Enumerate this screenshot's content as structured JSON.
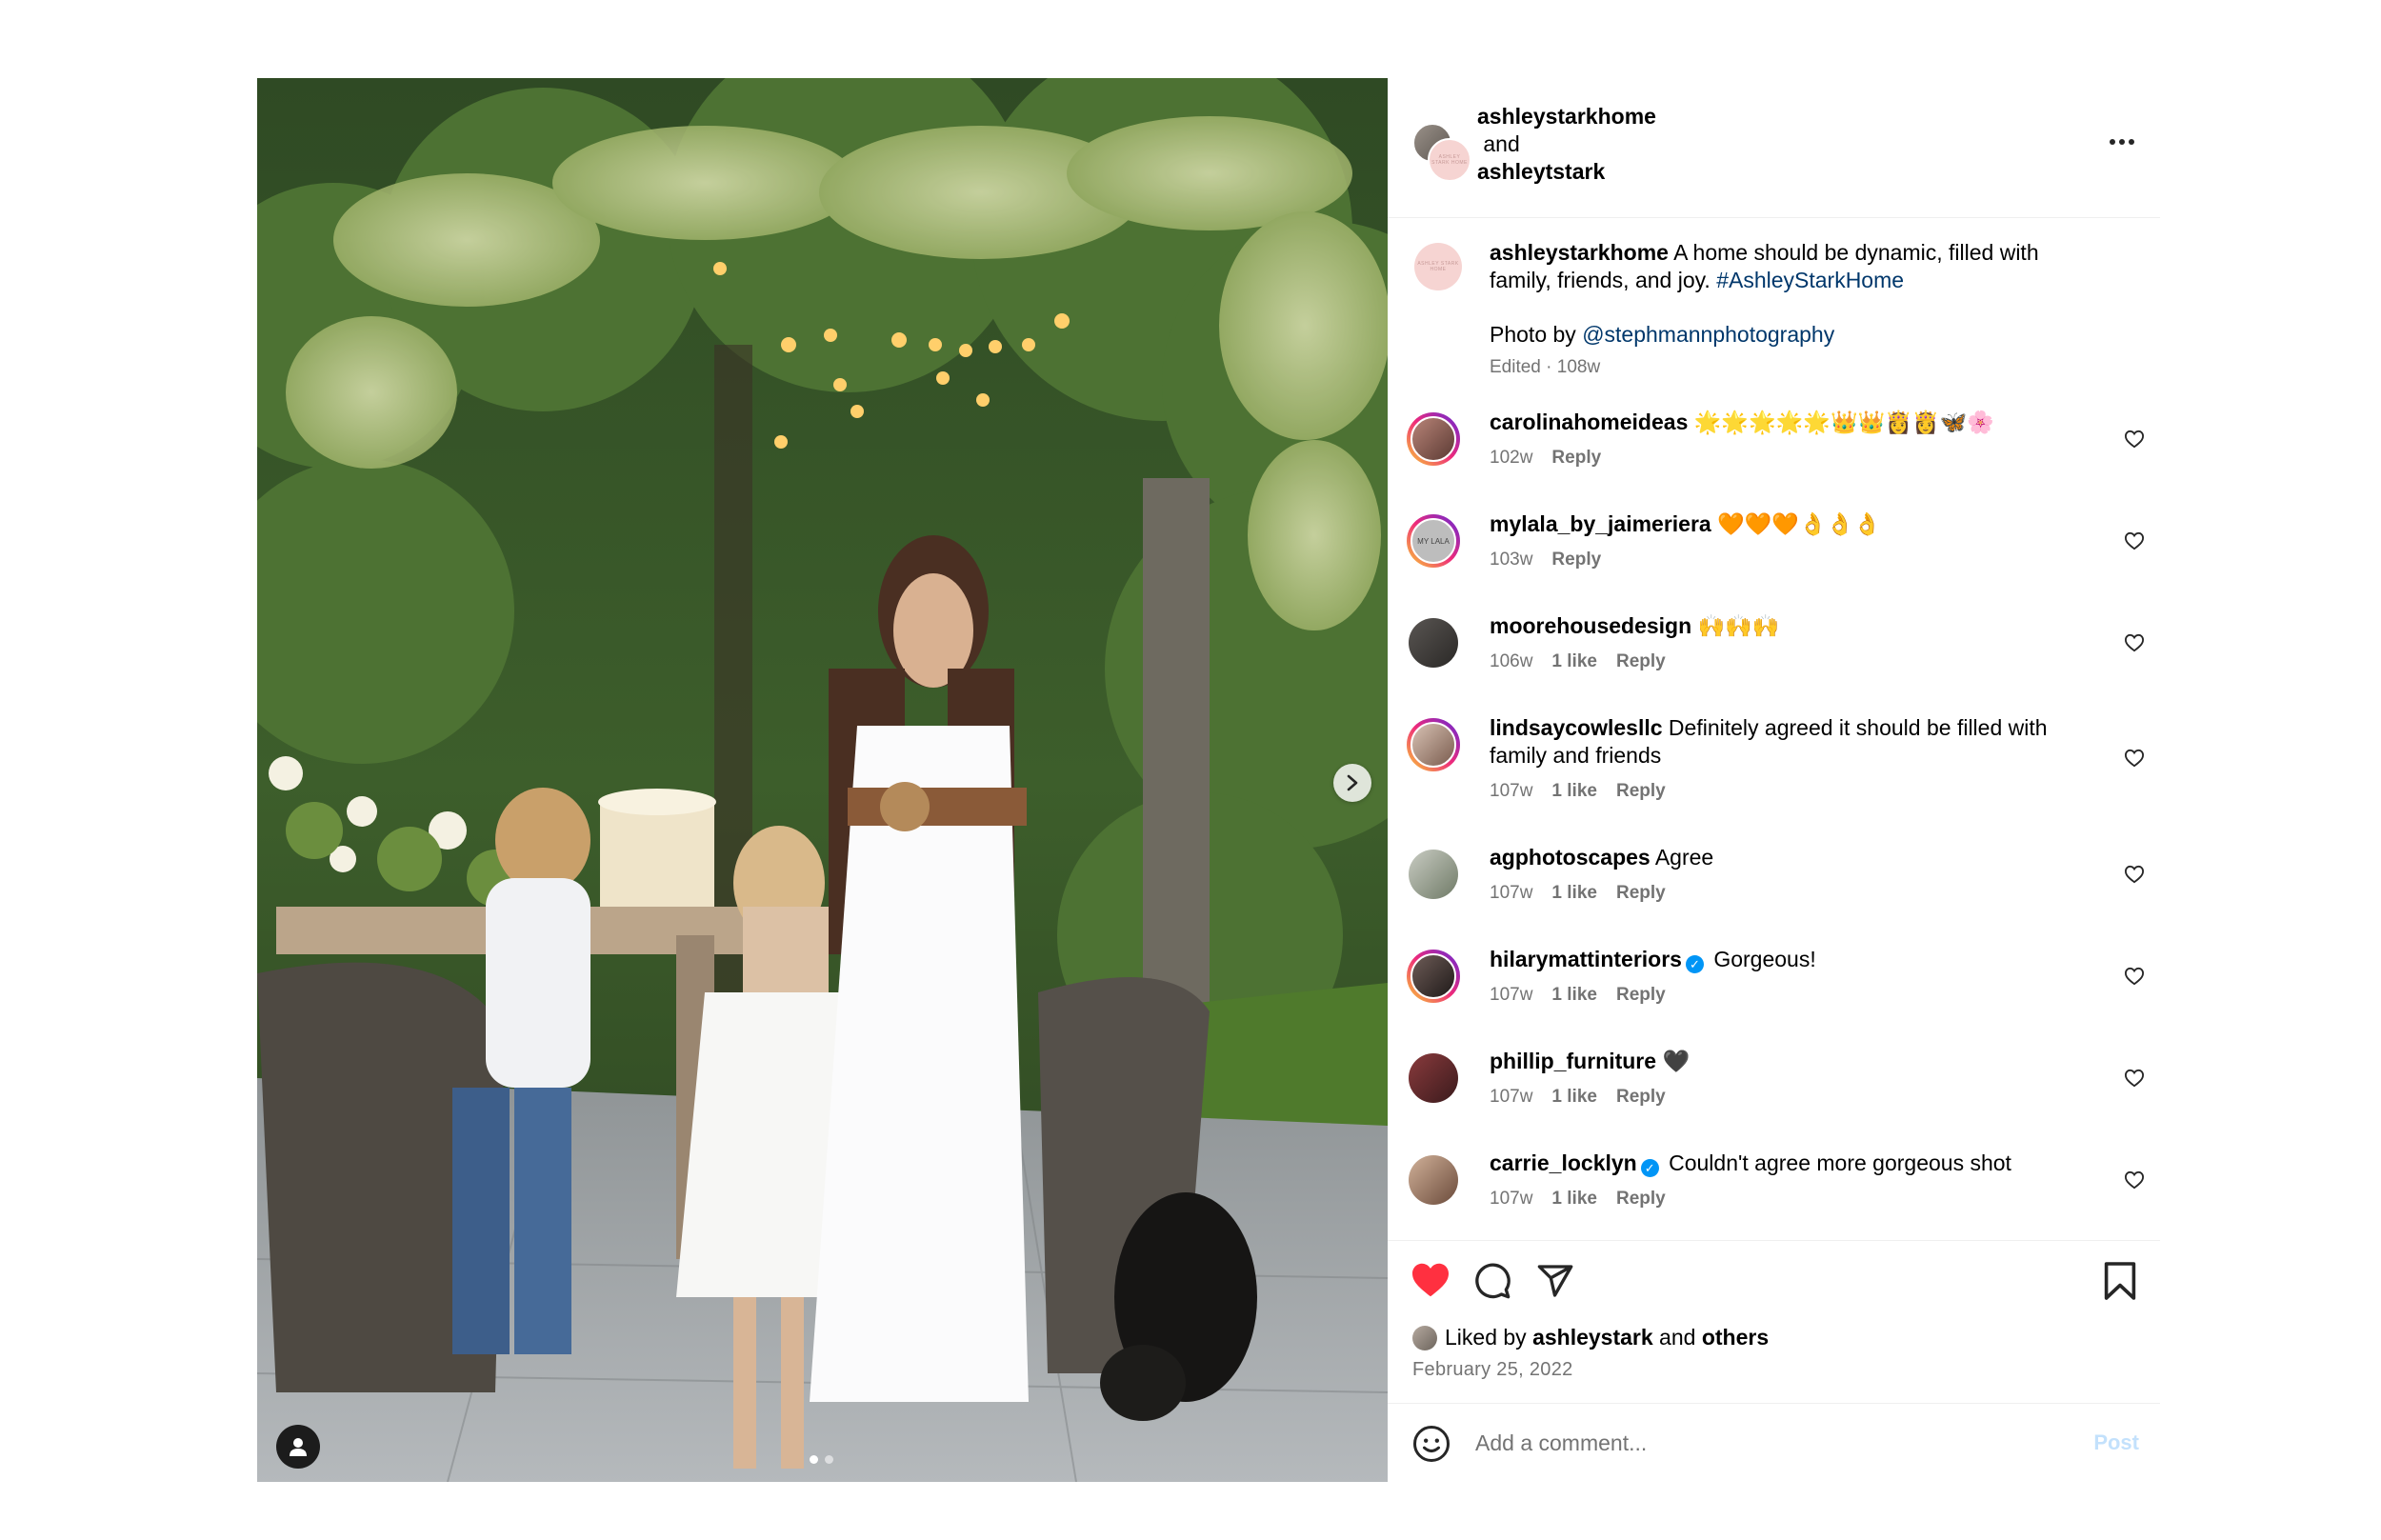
{
  "header": {
    "user1": "ashleystarkhome",
    "connector": "and",
    "user2": "ashleytstark",
    "mini_logo": "ASHLEY STARK HOME"
  },
  "caption": {
    "user": "ashleystarkhome",
    "text": "A home should be dynamic, filled with family, friends, and joy.",
    "hashtag": "#AshleyStarkHome",
    "photo_by": "Photo by",
    "photo_handle": "@stephmannphotography",
    "meta": "Edited · 108w"
  },
  "comments": [
    {
      "user": "carolinahomeideas",
      "text": "🌟🌟🌟🌟🌟👑👑👸👸🦋🌸",
      "time": "102w",
      "likes": "",
      "reply": "Reply",
      "verified": false
    },
    {
      "user": "mylala_by_jaimeriera",
      "text": "🧡🧡🧡👌👌👌",
      "time": "103w",
      "likes": "",
      "reply": "Reply",
      "verified": false,
      "avatar_text": "MY LALA"
    },
    {
      "user": "moorehousedesign",
      "text": "🙌🙌🙌",
      "time": "106w",
      "likes": "1 like",
      "reply": "Reply",
      "verified": false
    },
    {
      "user": "lindsaycowlesllc",
      "text": "Definitely agreed it should be filled with family and friends",
      "time": "107w",
      "likes": "1 like",
      "reply": "Reply",
      "verified": false
    },
    {
      "user": "agphotoscapes",
      "text": "Agree",
      "time": "107w",
      "likes": "1 like",
      "reply": "Reply",
      "verified": false
    },
    {
      "user": "hilarymattinteriors",
      "text": "Gorgeous!",
      "time": "107w",
      "likes": "1 like",
      "reply": "Reply",
      "verified": true
    },
    {
      "user": "phillip_furniture",
      "text": "🖤",
      "time": "107w",
      "likes": "1 like",
      "reply": "Reply",
      "verified": false
    },
    {
      "user": "carrie_locklyn",
      "text": "Couldn't agree more gorgeous shot",
      "time": "107w",
      "likes": "1 like",
      "reply": "Reply",
      "verified": true
    }
  ],
  "liked": {
    "prefix": "Liked by",
    "user": "ashleystark",
    "mid": "and",
    "others": "others"
  },
  "date": "February 25, 2022",
  "add_comment": {
    "placeholder": "Add a comment...",
    "post_label": "Post"
  },
  "carousel": {
    "count": 2,
    "active": 0
  },
  "colors": {
    "like_red": "#ff3040",
    "link_blue": "#00376b",
    "verified_blue": "#0095f6",
    "post_disabled": "#c3e1fc"
  }
}
